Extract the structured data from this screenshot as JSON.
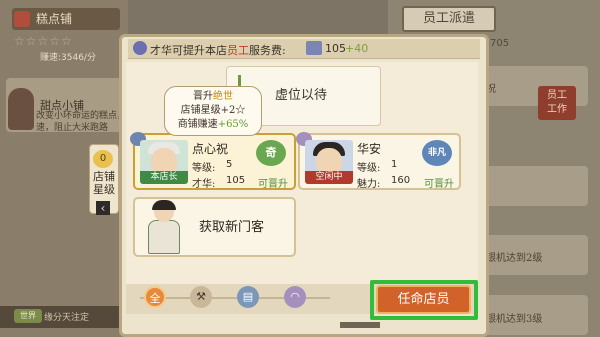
{
  "background": {
    "shop_title": "糕点铺",
    "stars": "☆☆☆☆☆",
    "speed": "赚速:3546/分",
    "panel_title": "甜点小铺",
    "panel_text": "改变小环命运的糕点，\n速，阻止大米跑路",
    "bottom_tag": "世界",
    "bottom_text": "缘分天注定",
    "dispatch_title": "员工派遣",
    "dispatch_count": "705",
    "worker_btn": "员工\n工作",
    "rows": [
      "公祝",
      "待",
      "收银机达到2级",
      "收银机达到3级"
    ]
  },
  "header": {
    "hint_prefix": "才华可提升本店",
    "hint_highlight": "员工",
    "hint_suffix": "服务费:",
    "fee_value": "105",
    "fee_plus": "+40"
  },
  "vacant": {
    "label": "虚位以待"
  },
  "tooltip": {
    "line1_prefix": "晋升",
    "line1_gold": "绝世",
    "line2": "店铺星级+2☆",
    "line3_prefix": "商铺赚速",
    "line3_green": "+65%"
  },
  "side": {
    "badge": "0",
    "label": "店铺星级"
  },
  "staff": [
    {
      "name": "点心祝",
      "level_label": "等级:",
      "level": "5",
      "stat_label": "才华:",
      "stat_value": "105",
      "tag": "本店长",
      "stamp": "奇",
      "upgrade": "可晋升"
    },
    {
      "name": "华安",
      "level_label": "等级:",
      "level": "1",
      "stat_label": "魅力:",
      "stat_value": "160",
      "tag": "空闲中",
      "stamp": "非凡",
      "upgrade": "可晋升"
    }
  ],
  "recruit": {
    "label": "获取新门客"
  },
  "filters": {
    "all": "全"
  },
  "appoint": {
    "label": "任命店员"
  },
  "colors": {
    "modal_bg": "#ede4cd",
    "highlight": "#33bb3a",
    "appoint_btn": "#d1622a",
    "upgrade_green": "#4f8f35"
  }
}
